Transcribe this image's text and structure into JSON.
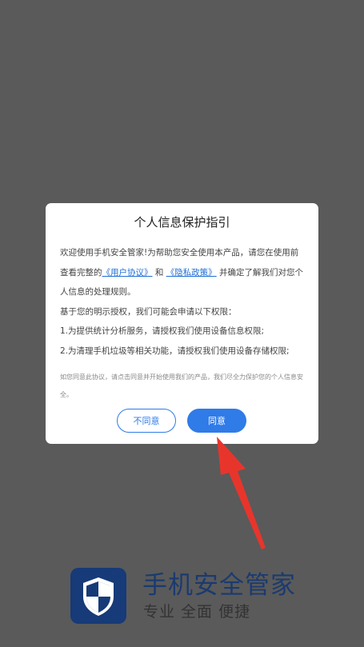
{
  "dialog": {
    "title": "个人信息保护指引",
    "intro_before": "欢迎使用手机安全管家!为帮助您安全使用本产品，请您在使用前查看完整的",
    "link_user_agreement": "《用户协议》",
    "and_text": "和",
    "link_privacy_policy": "《隐私政策》",
    "intro_after": "并确定了解我们对您个人信息的处理规则。",
    "permissions_intro": "基于您的明示授权，我们可能会申请以下权限：",
    "permission_1": "1.为提供统计分析服务，请授权我们使用设备信息权限;",
    "permission_2": "2.为清理手机垃圾等相关功能，请授权我们使用设备存储权限;",
    "notice": "如您同意此协议，请点击同意并开始使用我们的产品，我们尽全力保护您的个人信息安全。",
    "disagree_label": "不同意",
    "agree_label": "同意"
  },
  "brand": {
    "name": "手机安全管家",
    "slogan": "专业 全面 便捷",
    "logo_icon": "shield-icon"
  },
  "colors": {
    "overlay": "#5a5a5a",
    "accent": "#2f7be8",
    "link": "#1f6fd6",
    "arrow": "#e8352c",
    "brand_dark": "#173a78"
  }
}
